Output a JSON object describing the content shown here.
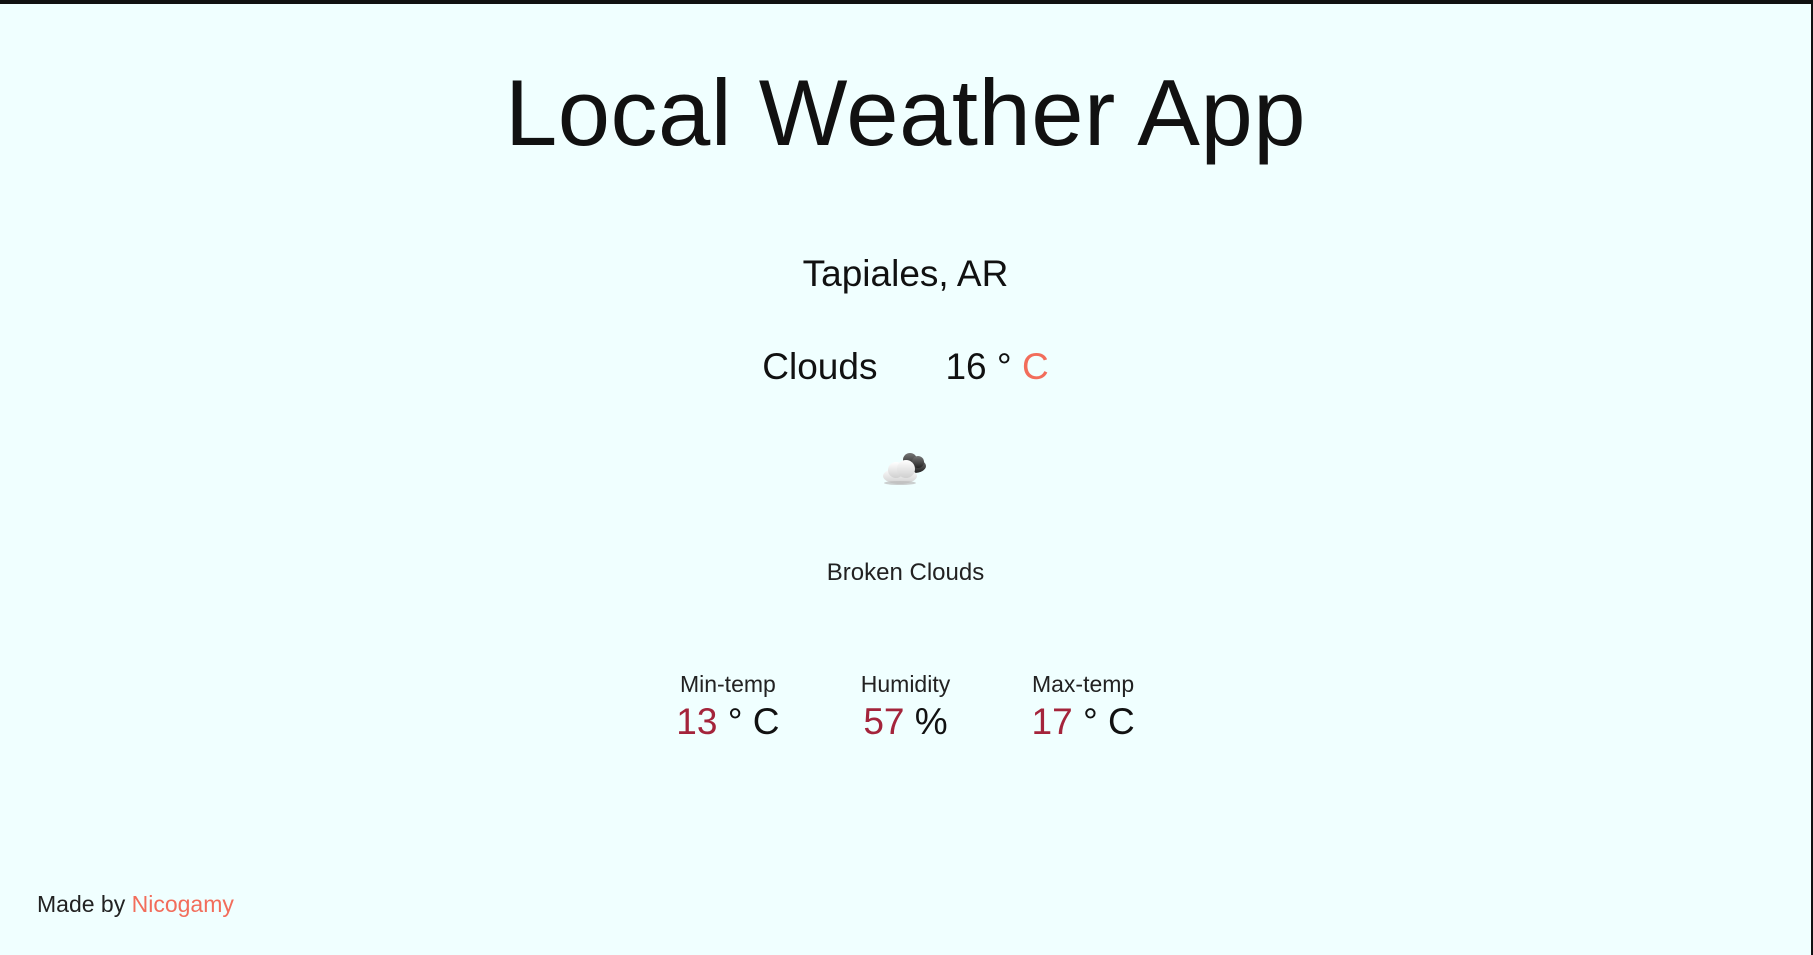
{
  "app": {
    "title": "Local Weather App"
  },
  "weather": {
    "location": "Tapiales, AR",
    "condition": "Clouds",
    "temp_value": "16",
    "temp_degree": "°",
    "temp_unit": "C",
    "icon": "broken-clouds-icon",
    "description": "Broken Clouds"
  },
  "stats": {
    "min": {
      "label": "Min-temp",
      "value": "13",
      "suffix": "° C"
    },
    "humidity": {
      "label": "Humidity",
      "value": "57",
      "suffix": "%"
    },
    "max": {
      "label": "Max-temp",
      "value": "17",
      "suffix": "° C"
    }
  },
  "footer": {
    "prefix": "Made by",
    "author": "Nicogamy"
  },
  "colors": {
    "background": "#f0ffff",
    "accent": "#f26d5b",
    "number_red": "#a4243b"
  }
}
